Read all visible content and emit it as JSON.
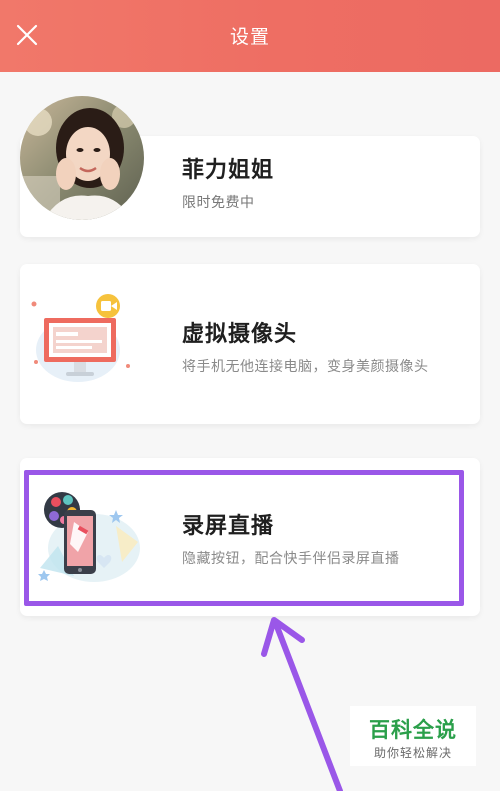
{
  "header": {
    "title": "设置",
    "close_icon": "close-icon",
    "background": "#ee6e63"
  },
  "cards": [
    {
      "title": "菲力姐姐",
      "subtitle": "限时免费中",
      "image": "user-avatar-photo"
    },
    {
      "title": "虚拟摄像头",
      "subtitle": "将手机无他连接电脑，变身美颜摄像头",
      "image": "monitor-camera-illustration"
    },
    {
      "title": "录屏直播",
      "subtitle": "隐藏按钮，配合快手伴侣录屏直播",
      "image": "phone-live-illustration"
    }
  ],
  "annotation": {
    "highlight_color": "#9a57e8",
    "arrow": "arrow-icon"
  },
  "watermark": {
    "title": "百科全说",
    "subtitle": "助你轻松解决",
    "color": "#2a9f4a"
  }
}
